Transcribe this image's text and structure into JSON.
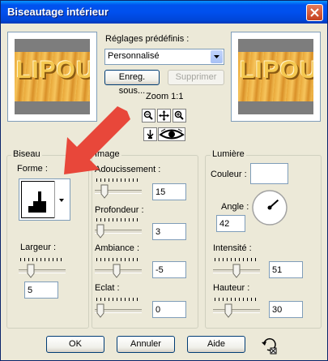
{
  "window": {
    "title": "Biseautage intérieur"
  },
  "preview": {
    "text": "LIPOU"
  },
  "presets": {
    "label": "Réglages prédéfinis :",
    "selected": "Personnalisé",
    "save_label": "Enreg. sous...",
    "delete_label": "Supprimer"
  },
  "zoom": {
    "label": "Zoom 1:1"
  },
  "bevel": {
    "group_label": "Biseau",
    "shape_label": "Forme :",
    "width_label": "Largeur :",
    "width_value": "5",
    "width_level": 0.2
  },
  "image": {
    "group_label": "Image",
    "smoothing_label": "Adoucissement :",
    "smoothing_value": "15",
    "smoothing_level": 0.15,
    "depth_label": "Profondeur :",
    "depth_value": "3",
    "depth_level": 0.05,
    "ambience_label": "Ambiance :",
    "ambience_value": "-5",
    "ambience_level": 0.45,
    "shine_label": "Eclat :",
    "shine_value": "0",
    "shine_level": 0.05
  },
  "light": {
    "group_label": "Lumière",
    "color_label": "Couleur :",
    "color": "#ffffff",
    "angle_label": "Angle :",
    "angle_value": "42",
    "intensity_label": "Intensité :",
    "intensity_value": "51",
    "intensity_level": 0.51,
    "height_label": "Hauteur :",
    "height_value": "30",
    "height_level": 0.3
  },
  "footer": {
    "ok_label": "OK",
    "cancel_label": "Annuler",
    "help_label": "Aide"
  },
  "annotation": {
    "arrow_color": "#e8473a"
  },
  "icons": [
    "close-icon",
    "zoom-out-icon",
    "pan-icon",
    "zoom-in-icon",
    "pointer-icon",
    "eye-icon",
    "dropdown-arrow-icon",
    "reset-icon"
  ]
}
